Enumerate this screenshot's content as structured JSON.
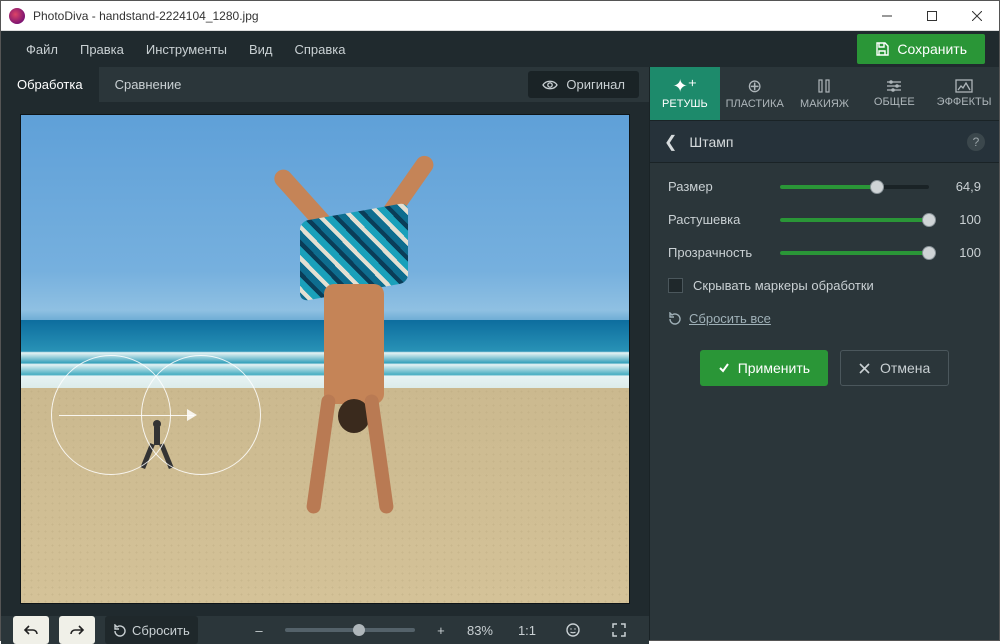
{
  "titlebar": {
    "app": "PhotoDiva",
    "filename": "handstand-2224104_1280.jpg"
  },
  "menu": {
    "file": "Файл",
    "edit": "Правка",
    "tools": "Инструменты",
    "view": "Вид",
    "help": "Справка"
  },
  "save_button": "Сохранить",
  "tabs": {
    "processing": "Обработка",
    "compare": "Сравнение"
  },
  "original_button": "Оригинал",
  "bottom": {
    "reset": "Сбросить",
    "zoom_percent": "83%",
    "one_to_one": "1:1"
  },
  "tool_tabs": {
    "retouch": "РЕТУШЬ",
    "liquify": "ПЛАСТИКА",
    "makeup": "МАКИЯЖ",
    "general": "ОБЩЕЕ",
    "effects": "ЭФФЕКТЫ"
  },
  "panel": {
    "title": "Штамп",
    "size_label": "Размер",
    "size_value": "64,9",
    "feather_label": "Растушевка",
    "feather_value": "100",
    "opacity_label": "Прозрачность",
    "opacity_value": "100",
    "hide_markers": "Скрывать маркеры обработки",
    "reset_all": "Сбросить все",
    "apply": "Применить",
    "cancel": "Отмена"
  }
}
